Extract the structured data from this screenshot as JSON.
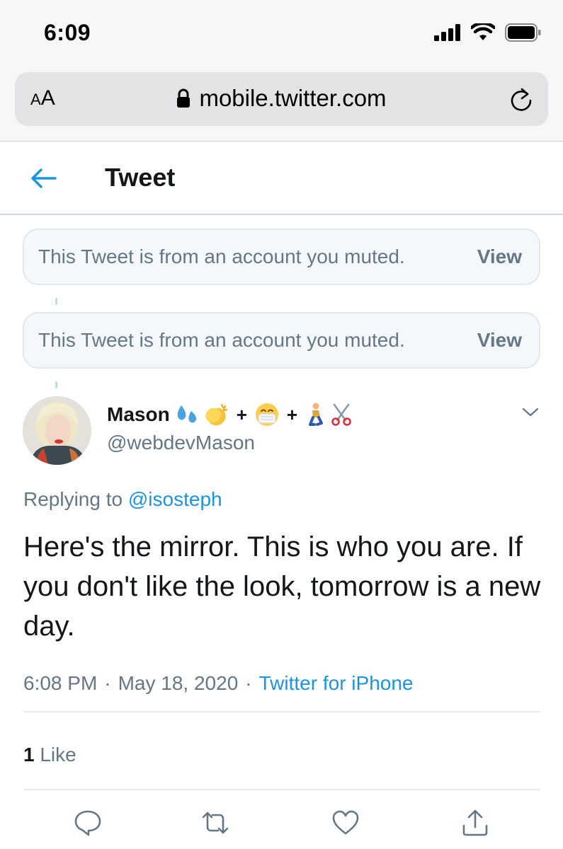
{
  "status_bar": {
    "time": "6:09",
    "icons": [
      "signal-icon",
      "wifi-icon",
      "battery-icon"
    ]
  },
  "browser": {
    "text_size_label_small": "A",
    "text_size_label_large": "A",
    "url": "mobile.twitter.com",
    "lock_icon": "lock-icon",
    "reload_icon": "reload-icon"
  },
  "header": {
    "title": "Tweet",
    "back_icon": "back-arrow-icon"
  },
  "muted_tweets": [
    {
      "text": "This Tweet is from an account you muted.",
      "action": "View"
    },
    {
      "text": "This Tweet is from an account you muted.",
      "action": "View"
    }
  ],
  "tweet": {
    "display_name": "Mason",
    "name_emoji": [
      "💦👏",
      "+",
      "😷",
      "+",
      "🧎",
      "✂️"
    ],
    "handle": "@webdevMason",
    "replying_prefix": "Replying to",
    "replying_to": "@isosteph",
    "text": "Here's the mirror. This is who you are. If you don't like the look, tomorrow is a new day.",
    "time": "6:08 PM",
    "date": "May 18, 2020",
    "separator": "·",
    "source": "Twitter for iPhone",
    "likes_count": "1",
    "likes_label": "Like"
  },
  "actions": [
    "reply-icon",
    "retweet-icon",
    "like-icon",
    "share-icon"
  ],
  "colors": {
    "twitter_blue": "#1b95e0",
    "secondary_text": "#657786",
    "primary_text": "#14171a",
    "muted_box_bg": "#f5f8fa",
    "divider": "#e6ecf0"
  }
}
